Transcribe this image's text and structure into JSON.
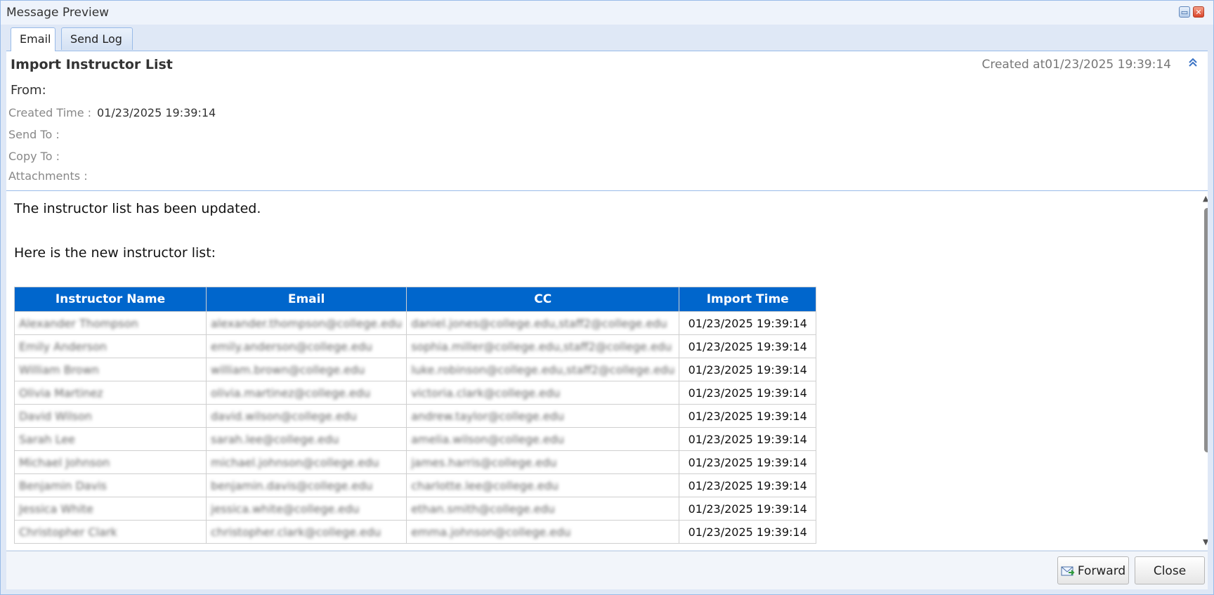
{
  "window": {
    "title": "Message Preview"
  },
  "tabs": [
    {
      "label": "Email",
      "active": true
    },
    {
      "label": "Send Log",
      "active": false
    }
  ],
  "message": {
    "subject": "Import Instructor List",
    "created_at_label": "Created at",
    "created_at_value": "01/23/2025 19:39:14",
    "from_label": "From:",
    "created_time_label": "Created Time :",
    "created_time_value": "01/23/2025 19:39:14",
    "send_to_label": "Send To :",
    "copy_to_label": "Copy To :",
    "attachments_label": "Attachments :"
  },
  "body": {
    "line1": "The instructor list has been updated.",
    "line2": "Here is the new instructor list:"
  },
  "table": {
    "columns": [
      "Instructor Name",
      "Email",
      "CC",
      "Import Time"
    ],
    "rows": [
      [
        "Alexander Thompson",
        "alexander.thompson@college.edu",
        "daniel.jones@college.edu,staff2@college.edu",
        "01/23/2025 19:39:14"
      ],
      [
        "Emily Anderson",
        "emily.anderson@college.edu",
        "sophia.miller@college.edu,staff2@college.edu",
        "01/23/2025 19:39:14"
      ],
      [
        "William Brown",
        "william.brown@college.edu",
        "luke.robinson@college.edu,staff2@college.edu",
        "01/23/2025 19:39:14"
      ],
      [
        "Olivia Martinez",
        "olivia.martinez@college.edu",
        "victoria.clark@college.edu",
        "01/23/2025 19:39:14"
      ],
      [
        "David Wilson",
        "david.wilson@college.edu",
        "andrew.taylor@college.edu",
        "01/23/2025 19:39:14"
      ],
      [
        "Sarah Lee",
        "sarah.lee@college.edu",
        "amelia.wilson@college.edu",
        "01/23/2025 19:39:14"
      ],
      [
        "Michael Johnson",
        "michael.johnson@college.edu",
        "james.harris@college.edu",
        "01/23/2025 19:39:14"
      ],
      [
        "Benjamin Davis",
        "benjamin.davis@college.edu",
        "charlotte.lee@college.edu",
        "01/23/2025 19:39:14"
      ],
      [
        "Jessica White",
        "jessica.white@college.edu",
        "ethan.smith@college.edu",
        "01/23/2025 19:39:14"
      ],
      [
        "Christopher Clark",
        "christopher.clark@college.edu",
        "emma.johnson@college.edu",
        "01/23/2025 19:39:14"
      ]
    ]
  },
  "footer": {
    "forward_label": "Forward",
    "close_label": "Close"
  },
  "colors": {
    "table_header": "#0066cc",
    "window_border": "#99bbe8"
  },
  "icons": [
    "maximize-icon",
    "close-icon",
    "collapse-icon",
    "forward-mail-icon",
    "scroll-up-icon",
    "scroll-down-icon"
  ]
}
